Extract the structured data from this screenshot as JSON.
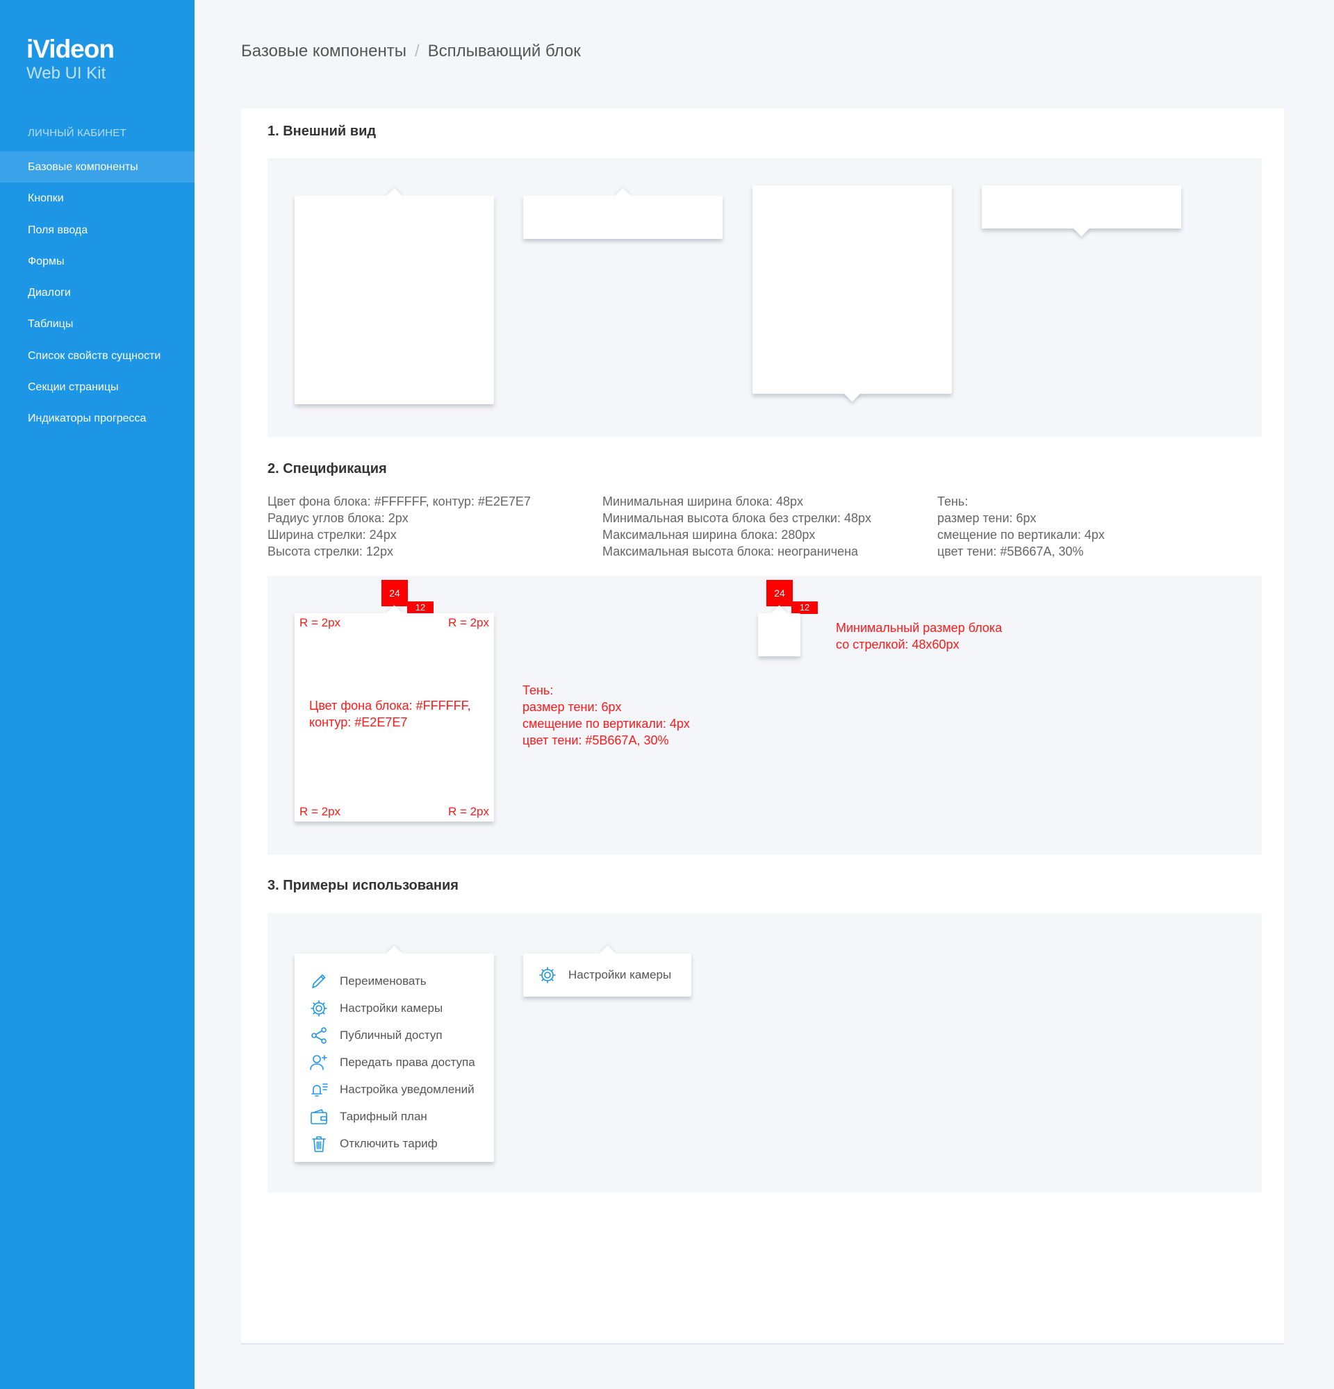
{
  "brand": {
    "logo": "iVideon",
    "subtitle": "Web UI Kit"
  },
  "sidebar": {
    "caption": "ЛИЧНЫЙ КАБИНЕТ",
    "items": [
      {
        "label": "Базовые компоненты"
      },
      {
        "label": "Кнопки"
      },
      {
        "label": "Поля ввода"
      },
      {
        "label": "Формы"
      },
      {
        "label": "Диалоги"
      },
      {
        "label": "Таблицы"
      },
      {
        "label": "Список свойств сущности"
      },
      {
        "label": "Секции страницы"
      },
      {
        "label": "Индикаторы прогресса"
      }
    ]
  },
  "breadcrumb": {
    "parent": "Базовые компоненты",
    "separator": "/",
    "current": "Всплывающий блок"
  },
  "sections": {
    "appearance": {
      "title": "1. Внешний вид"
    },
    "spec": {
      "title": "2. Спецификация",
      "col1": [
        "Цвет фона блока: #FFFFFF, контур: #E2E7E7",
        "Радиус углов блока: 2px",
        "Ширина стрелки: 24px",
        "Высота стрелки: 12px"
      ],
      "col2": [
        "Минимальная ширина блока: 48px",
        "Минимальная высота блока без стрелки: 48px",
        "Максимальная ширина блока: 280px",
        "Максимальная высота блока: неограничена"
      ],
      "col3": [
        "Тень:",
        "размер тени: 6px",
        "смещение по вертикали: 4px",
        "цвет тени: #5B667A, 30%"
      ]
    },
    "examples": {
      "title": "3. Примеры использования"
    }
  },
  "annotations": {
    "arrow_width": "24",
    "arrow_height": "12",
    "radius": "R = 2px",
    "bg_line1": "Цвет фона блока: #FFFFFF,",
    "bg_line2": "контур: #E2E7E7",
    "shadow": [
      "Тень:",
      "размер тени: 6px",
      "смещение по вертикали: 4px",
      "цвет тени: #5B667A, 30%"
    ],
    "minsize_line1": "Минимальный размер блока",
    "minsize_line2": "со стрелкой: 48x60px"
  },
  "menu": {
    "items": [
      {
        "label": "Переименовать",
        "icon": "pencil-icon"
      },
      {
        "label": "Настройки камеры",
        "icon": "gear-icon"
      },
      {
        "label": "Публичный доступ",
        "icon": "share-icon"
      },
      {
        "label": "Передать права доступа",
        "icon": "user-add-icon"
      },
      {
        "label": "Настройка уведомлений",
        "icon": "bell-icon"
      },
      {
        "label": "Тарифный план",
        "icon": "wallet-icon"
      },
      {
        "label": "Отключить тариф",
        "icon": "trash-icon"
      }
    ],
    "single": {
      "label": "Настройки камеры",
      "icon": "gear-icon"
    }
  },
  "colors": {
    "sidebar": "#1E96E6",
    "accent_red": "#FF0000",
    "panel": "#F5F6F9",
    "shadow": "#5B667A"
  }
}
